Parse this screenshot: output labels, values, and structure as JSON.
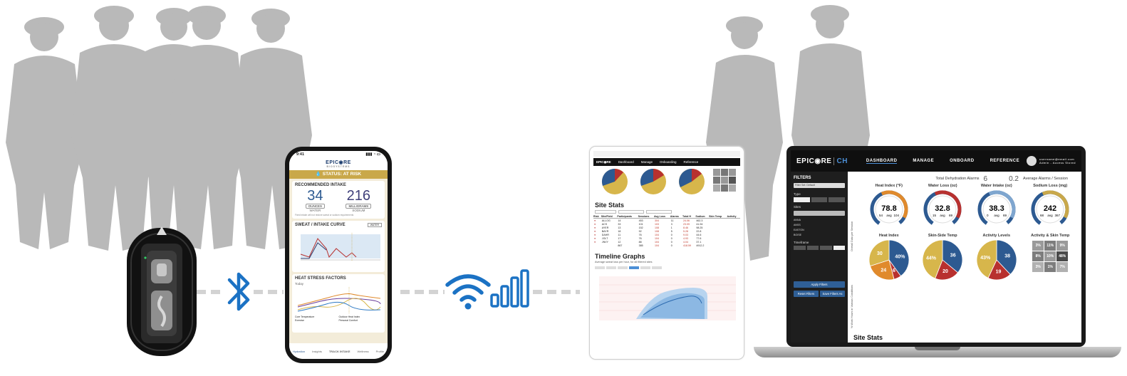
{
  "colors": {
    "brand_blue": "#1b72c4",
    "gold": "#c9a84a",
    "navy": "#2d5a91",
    "red": "#b8312f",
    "orange": "#e08a2c",
    "gray_silhouette": "#b9b9b9"
  },
  "icons": {
    "bluetooth": "bluetooth-icon",
    "wifi": "wifi-icon",
    "signal": "signal-bars-icon"
  },
  "phone": {
    "time": "9:41",
    "logo": "EPIC◉RE",
    "logo_sub": "BIOSYSTEMS",
    "status_prefix": "STATUS:",
    "status_value": "AT RISK",
    "card1_title": "RECOMMENDED INTAKE",
    "water_value": "34",
    "water_unit": "OUNCES",
    "water_label": "WATER",
    "sodium_value": "216",
    "sodium_unit": "MILLIGRAMS",
    "sodium_label": "SODIUM",
    "card1_note": "Fixed intake will not restore sweat or sodium requirements",
    "card2_title": "SWEAT / INTAKE CURVE",
    "card2_toggle": "WATER",
    "card3_title": "HEAT STRESS FACTORS",
    "card3_today": "Today",
    "legend": [
      "Core Temperature",
      "Outdoor Heat Index",
      "Exercise",
      "Personal Comfort"
    ],
    "nav": [
      "Hydration",
      "Insights",
      "TRACK INTAKE",
      "Wellness",
      "Profile"
    ]
  },
  "tablet": {
    "nav_brand": "EPIC◉RE",
    "nav": [
      "Dashboard",
      "Manage",
      "Onboarding",
      "Reference"
    ],
    "site_stats": "Site Stats",
    "timeline": "Timeline Graphs",
    "timeline_sub": "Average sweat loss per hour, for all filtered sites",
    "table_cols": [
      "Risk",
      "Site/Field",
      "Participants",
      "Sessions",
      "Avg Loss",
      "Alarms",
      "Total H",
      "Sodium",
      "Skin Temp",
      "Activity"
    ],
    "table_rows": [
      [
        "●",
        "ALLOG",
        "14",
        "453",
        "304",
        "11",
        "24.06",
        "462.3"
      ],
      [
        "●",
        "ACS",
        "33",
        "101",
        "103",
        "3",
        "23.09",
        "41.94"
      ],
      [
        "●",
        "AYER",
        "13",
        "152",
        "108",
        "1",
        "8.46",
        "98.25"
      ],
      [
        "●",
        "BAYR",
        "18",
        "92",
        "108",
        "5",
        "5.28",
        "22.8"
      ],
      [
        "●",
        "DAHR",
        "11",
        "76",
        "104",
        "0",
        "9.03",
        "44.6"
      ],
      [
        "●",
        "JOLT",
        "17",
        "76",
        "104",
        "0",
        "4.93",
        "77.6"
      ],
      [
        "●",
        "JNVY",
        "12",
        "88",
        "104",
        "0",
        "4.04",
        "37.1"
      ],
      [
        "",
        "",
        "867",
        "385",
        "104",
        "0",
        "418.59",
        "4912.2"
      ]
    ]
  },
  "laptop": {
    "brand": "EPIC◉RE",
    "brand_suffix": "CH",
    "nav": [
      "DASHBOARD",
      "MANAGE",
      "ONBOARD",
      "REFERENCE"
    ],
    "user_email": "username@email.com",
    "user_role": "Admin - Access Stored",
    "filters": "FILTERS",
    "filter_select": "Filter Set: Default",
    "sidebar_labels": [
      "Type",
      "Sites",
      "Timeframe"
    ],
    "sites": [
      "ANNA",
      "ANSS",
      "EASTON",
      "BOISE"
    ],
    "apply_btn": "Apply Filters",
    "reset_btn": "Reset Filters",
    "save_btn": "Save Filters As",
    "alarms_title": "Total Dehydration Alarms",
    "alarms_value": "6",
    "avg_alarms_title": "Average Alarms / Session",
    "avg_alarms_value": "0.2",
    "row_label_1": "Overall Data per Session",
    "row_label_2": "% Work Hours in Various Conditions",
    "gauges": [
      {
        "title": "Heat Index (°F)",
        "value": "78.8",
        "min": "54",
        "max": "104",
        "avg": "avg",
        "color": "#e08a2c"
      },
      {
        "title": "Water Loss (oz)",
        "value": "32.8",
        "min": "15",
        "max": "69",
        "avg": "avg",
        "color": "#b8312f"
      },
      {
        "title": "Water Intake (oz)",
        "value": "38.3",
        "min": "0",
        "max": "69",
        "avg": "avg",
        "color": "#7fa6cf"
      },
      {
        "title": "Sodium Loss (mg)",
        "value": "242",
        "min": "68",
        "max": "367",
        "avg": "avg",
        "color": "#c9a84a"
      }
    ],
    "pies": [
      {
        "title": "Heat Index",
        "slices": [
          {
            "v": 40,
            "c": "#2d5a91"
          },
          {
            "v": 6,
            "c": "#b8312f"
          },
          {
            "v": 24,
            "c": "#e08a2c"
          },
          {
            "v": 30,
            "c": "#d7b64b"
          }
        ],
        "labels": [
          "40%",
          "6",
          "24",
          "30"
        ]
      },
      {
        "title": "Skin-Side Temp",
        "slices": [
          {
            "v": 36,
            "c": "#2d5a91"
          },
          {
            "v": 20,
            "c": "#b8312f"
          },
          {
            "v": 44,
            "c": "#d7b64b"
          }
        ],
        "labels": [
          "36",
          "20",
          "44%"
        ]
      },
      {
        "title": "Activity Levels",
        "slices": [
          {
            "v": 38,
            "c": "#2d5a91"
          },
          {
            "v": 19,
            "c": "#b8312f"
          },
          {
            "v": 43,
            "c": "#d7b64b"
          }
        ],
        "labels": [
          "38",
          "19",
          "43%"
        ]
      }
    ],
    "heatmap_title": "Activity & Skin Temp",
    "heatmap": [
      "3%",
      "11%",
      "9%",
      "8%",
      "10%",
      "48%",
      "3%",
      "1%",
      "7%"
    ],
    "site_stats": "Site Stats"
  }
}
